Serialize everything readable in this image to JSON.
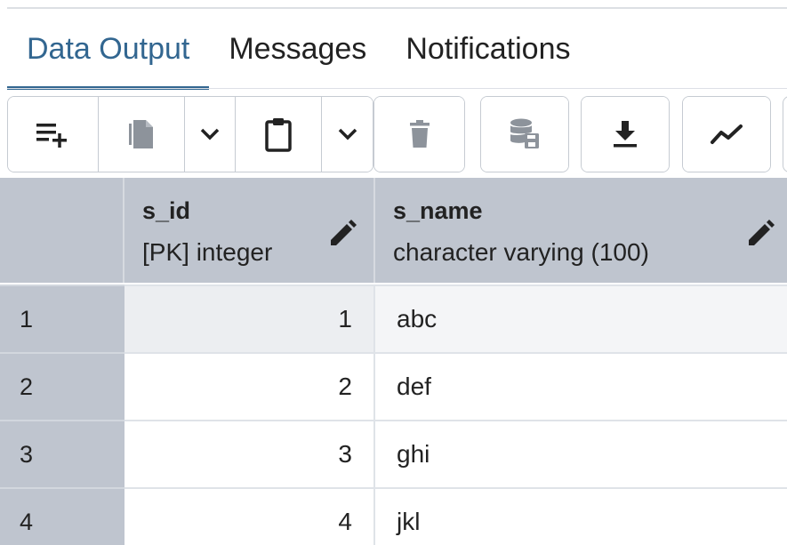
{
  "tabs": [
    {
      "label": "Data Output",
      "active": true
    },
    {
      "label": "Messages",
      "active": false
    },
    {
      "label": "Notifications",
      "active": false
    }
  ],
  "toolbar": {
    "buttons": [
      {
        "icon": "add-row-icon"
      },
      {
        "icon": "copy-icon"
      },
      {
        "icon": "chevron-down-icon"
      },
      {
        "icon": "paste-icon"
      },
      {
        "icon": "chevron-down-icon"
      },
      {
        "icon": "delete-icon"
      },
      {
        "icon": "save-data-icon"
      },
      {
        "icon": "download-icon"
      },
      {
        "icon": "graph-visualiser-icon"
      }
    ]
  },
  "columns": [
    {
      "name": "s_id",
      "type": "[PK] integer"
    },
    {
      "name": "s_name",
      "type": "character varying (100)"
    }
  ],
  "rows": [
    {
      "num": "1",
      "s_id": "1",
      "s_name": "abc"
    },
    {
      "num": "2",
      "s_id": "2",
      "s_name": "def"
    },
    {
      "num": "3",
      "s_id": "3",
      "s_name": "ghi"
    },
    {
      "num": "4",
      "s_id": "4",
      "s_name": "jkl"
    }
  ],
  "colors": {
    "accent": "#326690",
    "header_bg": "#bfc5cf",
    "selected_row_bg": "#eceef1"
  }
}
